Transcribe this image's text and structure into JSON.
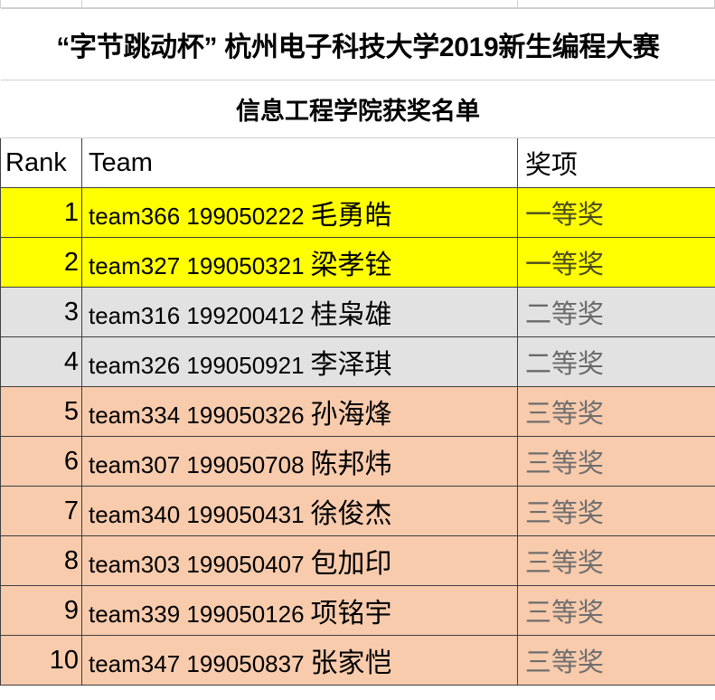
{
  "document": {
    "title_line_1": "“字节跳动杯” 杭州电子科技大学2019新生编程大赛",
    "title_line_2": "信息工程学院获奖名单"
  },
  "table": {
    "headers": {
      "rank": "Rank",
      "team": "Team",
      "award": "奖项"
    },
    "rows": [
      {
        "rank": "1",
        "team_code": "team366  199050222",
        "team_name": "毛勇皓",
        "award": "一等奖",
        "fill": "yellow"
      },
      {
        "rank": "2",
        "team_code": "team327  199050321",
        "team_name": "梁孝铨",
        "award": "一等奖",
        "fill": "yellow"
      },
      {
        "rank": "3",
        "team_code": "team316  199200412",
        "team_name": "桂枭雄",
        "award": "二等奖",
        "fill": "gray"
      },
      {
        "rank": "4",
        "team_code": "team326  199050921",
        "team_name": "李泽琪",
        "award": "二等奖",
        "fill": "gray"
      },
      {
        "rank": "5",
        "team_code": "team334  199050326",
        "team_name": "孙海烽",
        "award": "三等奖",
        "fill": "orange"
      },
      {
        "rank": "6",
        "team_code": "team307  199050708",
        "team_name": "陈邦炜",
        "award": "三等奖",
        "fill": "orange"
      },
      {
        "rank": "7",
        "team_code": "team340  199050431",
        "team_name": "徐俊杰",
        "award": "三等奖",
        "fill": "orange"
      },
      {
        "rank": "8",
        "team_code": "team303  199050407",
        "team_name": "包加印",
        "award": "三等奖",
        "fill": "orange"
      },
      {
        "rank": "9",
        "team_code": "team339  199050126",
        "team_name": "项铭宇",
        "award": "三等奖",
        "fill": "orange"
      },
      {
        "rank": "10",
        "team_code": "team347  199050837",
        "team_name": "张家恺",
        "award": "三等奖",
        "fill": "orange"
      }
    ]
  },
  "colors": {
    "first_prize_fill": "#FFFF00",
    "second_prize_fill": "#E2E2E2",
    "third_prize_fill": "#F8CBAD",
    "grid_line": "#3F3F3F",
    "light_grid_line": "#D0D0D0",
    "text": "#000000"
  }
}
